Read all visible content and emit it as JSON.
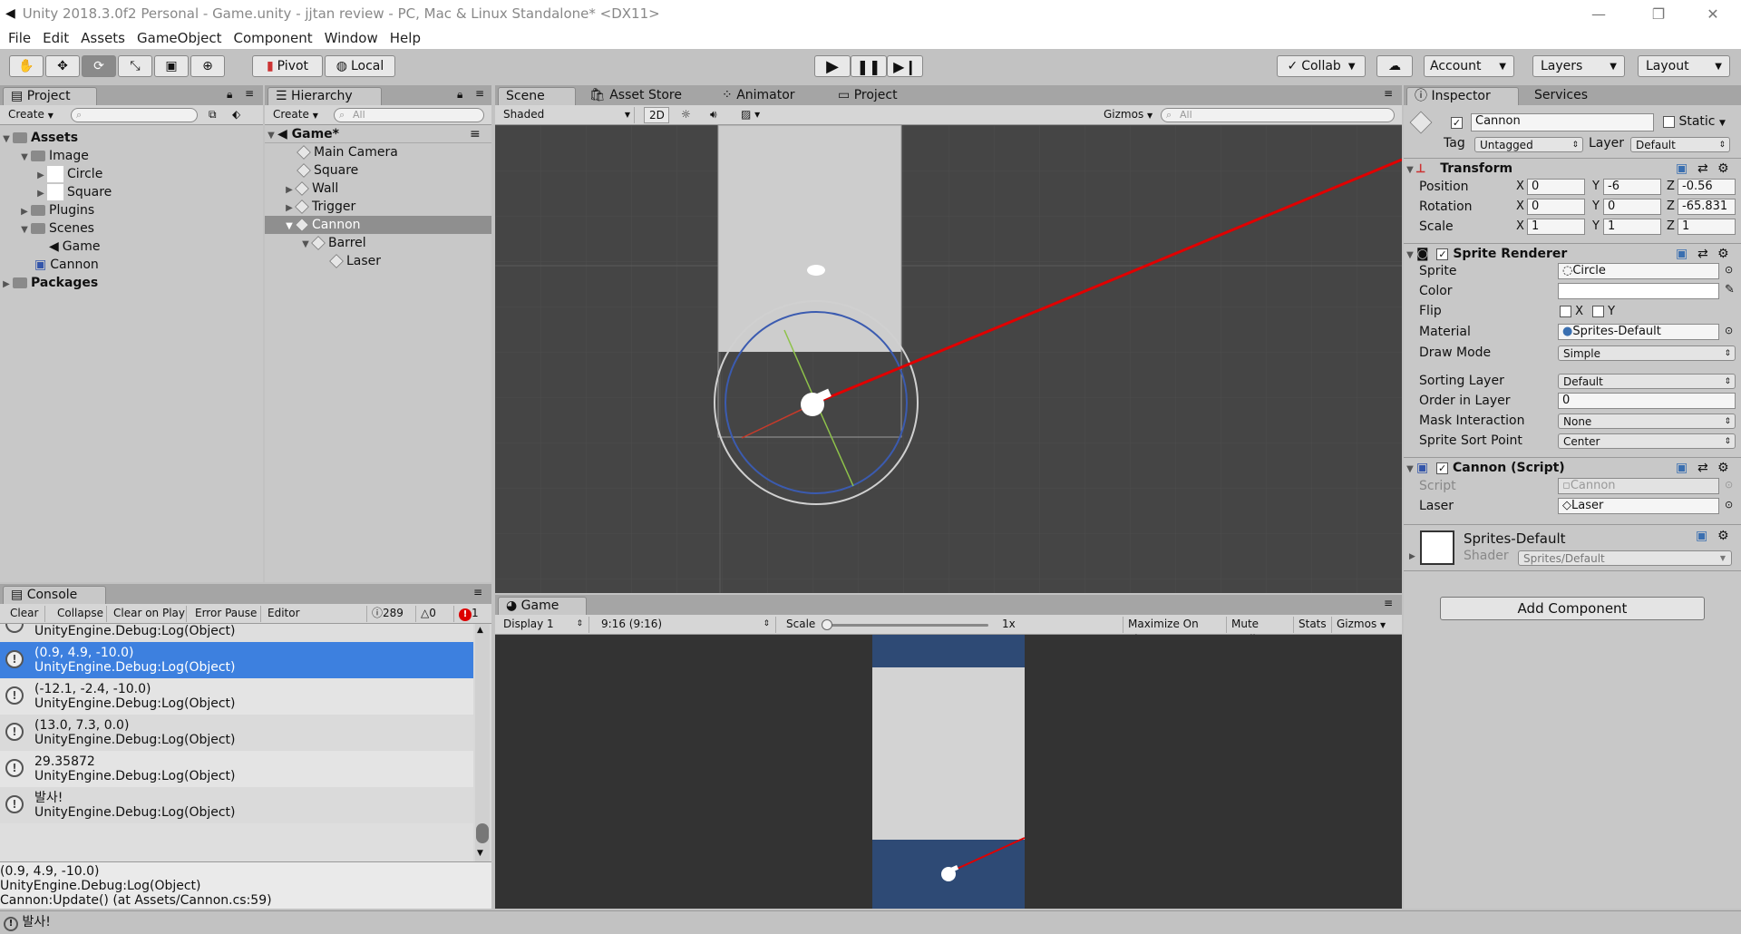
{
  "window": {
    "title": "Unity 2018.3.0f2 Personal - Game.unity - jjtan review - PC, Mac & Linux Standalone* <DX11>",
    "controls": [
      "—",
      "❐",
      "✕"
    ]
  },
  "menu": [
    "File",
    "Edit",
    "Assets",
    "GameObject",
    "Component",
    "Window",
    "Help"
  ],
  "toolbar": {
    "pivot": "Pivot",
    "local": "Local",
    "collab": "Collab",
    "account": "Account",
    "layers": "Layers",
    "layout": "Layout"
  },
  "project": {
    "tab": "Project",
    "create": "Create",
    "items": [
      {
        "label": "Assets",
        "bold": true
      },
      {
        "label": "Image"
      },
      {
        "label": "Circle"
      },
      {
        "label": "Square"
      },
      {
        "label": "Plugins"
      },
      {
        "label": "Scenes"
      },
      {
        "label": "Game"
      },
      {
        "label": "Cannon"
      },
      {
        "label": "Packages",
        "bold": true
      }
    ]
  },
  "hierarchy": {
    "tab": "Hierarchy",
    "create": "Create",
    "search": "All",
    "scene": "Game*",
    "items": [
      {
        "label": "Main Camera"
      },
      {
        "label": "Square"
      },
      {
        "label": "Wall"
      },
      {
        "label": "Trigger"
      },
      {
        "label": "Cannon",
        "selected": true
      },
      {
        "label": "Barrel"
      },
      {
        "label": "Laser"
      }
    ]
  },
  "scene": {
    "tabs": [
      "Scene",
      "Asset Store",
      "Animator",
      "Project"
    ],
    "shading": "Shaded",
    "mode2d": "2D",
    "gizmos": "Gizmos",
    "search": "All"
  },
  "game": {
    "tab": "Game",
    "display": "Display 1",
    "aspect": "9:16 (9:16)",
    "scale_label": "Scale",
    "scale_value": "1x",
    "buttons": [
      "Maximize On Play",
      "Mute Audio",
      "Stats",
      "Gizmos"
    ]
  },
  "console": {
    "tab": "Console",
    "buttons": [
      "Clear",
      "Collapse",
      "Clear on Play",
      "Error Pause",
      "Editor"
    ],
    "counts": {
      "log": "289",
      "warn": "0",
      "error": "1"
    },
    "partial_top": "UnityEngine.Debug:Log(Object)",
    "entries": [
      {
        "line1": "(0.9, 4.9, -10.0)",
        "line2": "UnityEngine.Debug:Log(Object)",
        "selected": true
      },
      {
        "line1": "(-12.1, -2.4, -10.0)",
        "line2": "UnityEngine.Debug:Log(Object)"
      },
      {
        "line1": "(13.0, 7.3, 0.0)",
        "line2": "UnityEngine.Debug:Log(Object)"
      },
      {
        "line1": "29.35872",
        "line2": "UnityEngine.Debug:Log(Object)"
      },
      {
        "line1": "발사!",
        "line2": "UnityEngine.Debug:Log(Object)"
      }
    ],
    "detail": [
      "(0.9, 4.9, -10.0)",
      "UnityEngine.Debug:Log(Object)",
      "Cannon:Update() (at Assets/Cannon.cs:59)"
    ]
  },
  "status": {
    "message": "발사!"
  },
  "inspector": {
    "tabs": [
      "Inspector",
      "Services"
    ],
    "object_name": "Cannon",
    "static": "Static",
    "tag_label": "Tag",
    "tag": "Untagged",
    "layer_label": "Layer",
    "layer": "Default",
    "transform": {
      "title": "Transform",
      "position": {
        "label": "Position",
        "x": "0",
        "y": "-6",
        "z": "-0.56"
      },
      "rotation": {
        "label": "Rotation",
        "x": "0",
        "y": "0",
        "z": "-65.831"
      },
      "scale": {
        "label": "Scale",
        "x": "1",
        "y": "1",
        "z": "1"
      }
    },
    "sprite_renderer": {
      "title": "Sprite Renderer",
      "sprite_label": "Sprite",
      "sprite": "Circle",
      "color_label": "Color",
      "flip_label": "Flip",
      "flip_x": "X",
      "flip_y": "Y",
      "material_label": "Material",
      "material": "Sprites-Default",
      "draw_mode_label": "Draw Mode",
      "draw_mode": "Simple",
      "sorting_layer_label": "Sorting Layer",
      "sorting_layer": "Default",
      "order_label": "Order in Layer",
      "order": "0",
      "mask_label": "Mask Interaction",
      "mask": "None",
      "sort_point_label": "Sprite Sort Point",
      "sort_point": "Center"
    },
    "cannon_script": {
      "title": "Cannon (Script)",
      "script_label": "Script",
      "script": "Cannon",
      "laser_label": "Laser",
      "laser": "Laser"
    },
    "material": {
      "name": "Sprites-Default",
      "shader_label": "Shader",
      "shader": "Sprites/Default"
    },
    "add_component": "Add Component"
  }
}
